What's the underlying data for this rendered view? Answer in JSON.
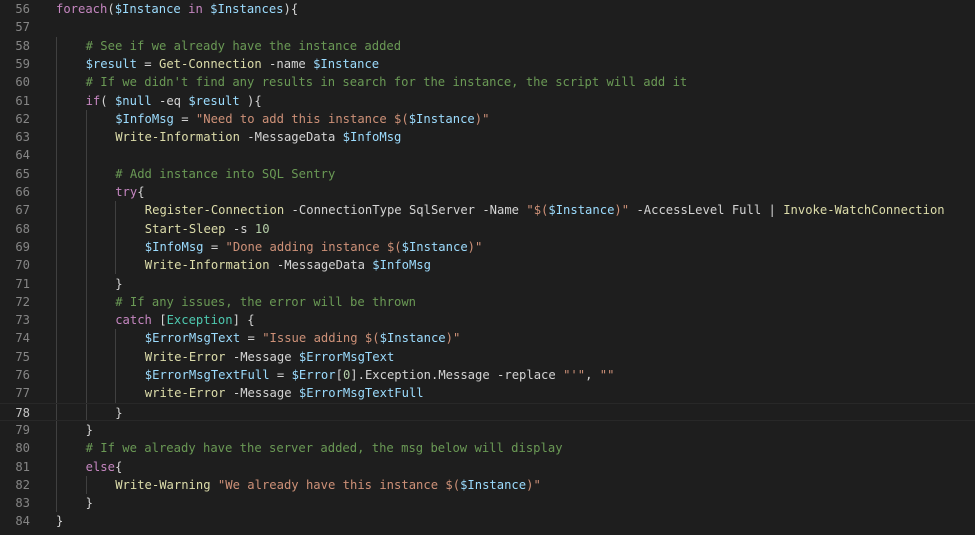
{
  "editor": {
    "language": "PowerShell",
    "theme": "dark",
    "current_line": 78,
    "colors": {
      "background": "#1e1e1e",
      "line_number": "#858585",
      "keyword": "#c586c0",
      "variable": "#9cdcfe",
      "function": "#dcdcaa",
      "string": "#ce9178",
      "comment": "#6a9955",
      "type": "#4ec9b0",
      "number": "#b5cea8",
      "plain": "#d4d4d4"
    },
    "lines": [
      {
        "number": "56",
        "indent": 0,
        "tokens": [
          {
            "t": "kw",
            "v": "foreach"
          },
          {
            "t": "op",
            "v": "("
          },
          {
            "t": "var",
            "v": "$Instance"
          },
          {
            "t": "op",
            "v": " "
          },
          {
            "t": "kw",
            "v": "in"
          },
          {
            "t": "op",
            "v": " "
          },
          {
            "t": "var",
            "v": "$Instances"
          },
          {
            "t": "op",
            "v": "){"
          }
        ]
      },
      {
        "number": "57",
        "indent": 0,
        "tokens": []
      },
      {
        "number": "58",
        "indent": 1,
        "tokens": [
          {
            "t": "cm",
            "v": "# See if we already have the instance added"
          }
        ]
      },
      {
        "number": "59",
        "indent": 1,
        "tokens": [
          {
            "t": "var",
            "v": "$result"
          },
          {
            "t": "op",
            "v": " = "
          },
          {
            "t": "fn",
            "v": "Get-Connection"
          },
          {
            "t": "param",
            "v": " -name "
          },
          {
            "t": "var",
            "v": "$Instance"
          }
        ]
      },
      {
        "number": "60",
        "indent": 1,
        "tokens": [
          {
            "t": "cm",
            "v": "# If we didn't find any results in search for the instance, the script will add it"
          }
        ]
      },
      {
        "number": "61",
        "indent": 1,
        "tokens": [
          {
            "t": "kw",
            "v": "if"
          },
          {
            "t": "op",
            "v": "( "
          },
          {
            "t": "var",
            "v": "$null"
          },
          {
            "t": "op",
            "v": " -eq "
          },
          {
            "t": "var",
            "v": "$result"
          },
          {
            "t": "op",
            "v": " ){"
          }
        ]
      },
      {
        "number": "62",
        "indent": 2,
        "tokens": [
          {
            "t": "var",
            "v": "$InfoMsg"
          },
          {
            "t": "op",
            "v": " = "
          },
          {
            "t": "str",
            "v": "\"Need to add this instance $("
          },
          {
            "t": "var",
            "v": "$Instance"
          },
          {
            "t": "str",
            "v": ")\""
          }
        ]
      },
      {
        "number": "63",
        "indent": 2,
        "tokens": [
          {
            "t": "fn",
            "v": "Write-Information"
          },
          {
            "t": "param",
            "v": " -MessageData "
          },
          {
            "t": "var",
            "v": "$InfoMsg"
          }
        ]
      },
      {
        "number": "64",
        "indent": 0,
        "tokens": []
      },
      {
        "number": "65",
        "indent": 2,
        "tokens": [
          {
            "t": "cm",
            "v": "# Add instance into SQL Sentry"
          }
        ]
      },
      {
        "number": "66",
        "indent": 2,
        "tokens": [
          {
            "t": "kw",
            "v": "try"
          },
          {
            "t": "op",
            "v": "{"
          }
        ]
      },
      {
        "number": "67",
        "indent": 3,
        "tokens": [
          {
            "t": "fn",
            "v": "Register-Connection"
          },
          {
            "t": "param",
            "v": " -ConnectionType SqlServer -Name "
          },
          {
            "t": "str",
            "v": "\"$("
          },
          {
            "t": "var",
            "v": "$Instance"
          },
          {
            "t": "str",
            "v": ")\""
          },
          {
            "t": "param",
            "v": " -AccessLevel Full | "
          },
          {
            "t": "fn",
            "v": "Invoke-WatchConnection"
          }
        ]
      },
      {
        "number": "68",
        "indent": 3,
        "tokens": [
          {
            "t": "fn",
            "v": "Start-Sleep"
          },
          {
            "t": "param",
            "v": " -s "
          },
          {
            "t": "num",
            "v": "10"
          }
        ]
      },
      {
        "number": "69",
        "indent": 3,
        "tokens": [
          {
            "t": "var",
            "v": "$InfoMsg"
          },
          {
            "t": "op",
            "v": " = "
          },
          {
            "t": "str",
            "v": "\"Done adding instance $("
          },
          {
            "t": "var",
            "v": "$Instance"
          },
          {
            "t": "str",
            "v": ")\""
          }
        ]
      },
      {
        "number": "70",
        "indent": 3,
        "tokens": [
          {
            "t": "fn",
            "v": "Write-Information"
          },
          {
            "t": "param",
            "v": " -MessageData "
          },
          {
            "t": "var",
            "v": "$InfoMsg"
          }
        ]
      },
      {
        "number": "71",
        "indent": 2,
        "tokens": [
          {
            "t": "op",
            "v": "}"
          }
        ]
      },
      {
        "number": "72",
        "indent": 2,
        "tokens": [
          {
            "t": "cm",
            "v": "# If any issues, the error will be thrown"
          }
        ]
      },
      {
        "number": "73",
        "indent": 2,
        "tokens": [
          {
            "t": "kw",
            "v": "catch"
          },
          {
            "t": "op",
            "v": " ["
          },
          {
            "t": "type",
            "v": "Exception"
          },
          {
            "t": "op",
            "v": "] {"
          }
        ]
      },
      {
        "number": "74",
        "indent": 3,
        "tokens": [
          {
            "t": "var",
            "v": "$ErrorMsgText"
          },
          {
            "t": "op",
            "v": " = "
          },
          {
            "t": "str",
            "v": "\"Issue adding $("
          },
          {
            "t": "var",
            "v": "$Instance"
          },
          {
            "t": "str",
            "v": ")\""
          }
        ]
      },
      {
        "number": "75",
        "indent": 3,
        "tokens": [
          {
            "t": "fn",
            "v": "Write-Error"
          },
          {
            "t": "param",
            "v": " -Message "
          },
          {
            "t": "var",
            "v": "$ErrorMsgText"
          }
        ]
      },
      {
        "number": "76",
        "indent": 3,
        "tokens": [
          {
            "t": "var",
            "v": "$ErrorMsgTextFull"
          },
          {
            "t": "op",
            "v": " = "
          },
          {
            "t": "var",
            "v": "$Error"
          },
          {
            "t": "op",
            "v": "["
          },
          {
            "t": "num",
            "v": "0"
          },
          {
            "t": "op",
            "v": "].Exception.Message -replace "
          },
          {
            "t": "str",
            "v": "\"'\""
          },
          {
            "t": "op",
            "v": ", "
          },
          {
            "t": "str",
            "v": "\"\""
          }
        ]
      },
      {
        "number": "77",
        "indent": 3,
        "tokens": [
          {
            "t": "fn",
            "v": "write-Error"
          },
          {
            "t": "param",
            "v": " -Message "
          },
          {
            "t": "var",
            "v": "$ErrorMsgTextFull"
          }
        ]
      },
      {
        "number": "78",
        "indent": 2,
        "tokens": [
          {
            "t": "op",
            "v": "}"
          }
        ]
      },
      {
        "number": "79",
        "indent": 1,
        "tokens": [
          {
            "t": "op",
            "v": "}"
          }
        ]
      },
      {
        "number": "80",
        "indent": 1,
        "tokens": [
          {
            "t": "cm",
            "v": "# If we already have the server added, the msg below will display"
          }
        ]
      },
      {
        "number": "81",
        "indent": 1,
        "tokens": [
          {
            "t": "kw",
            "v": "else"
          },
          {
            "t": "op",
            "v": "{"
          }
        ]
      },
      {
        "number": "82",
        "indent": 2,
        "tokens": [
          {
            "t": "fn",
            "v": "Write-Warning"
          },
          {
            "t": "op",
            "v": " "
          },
          {
            "t": "str",
            "v": "\"We already have this instance $("
          },
          {
            "t": "var",
            "v": "$Instance"
          },
          {
            "t": "str",
            "v": ")\""
          }
        ]
      },
      {
        "number": "83",
        "indent": 1,
        "tokens": [
          {
            "t": "op",
            "v": "}"
          }
        ]
      },
      {
        "number": "84",
        "indent": 0,
        "tokens": [
          {
            "t": "op",
            "v": "}"
          }
        ]
      }
    ]
  }
}
